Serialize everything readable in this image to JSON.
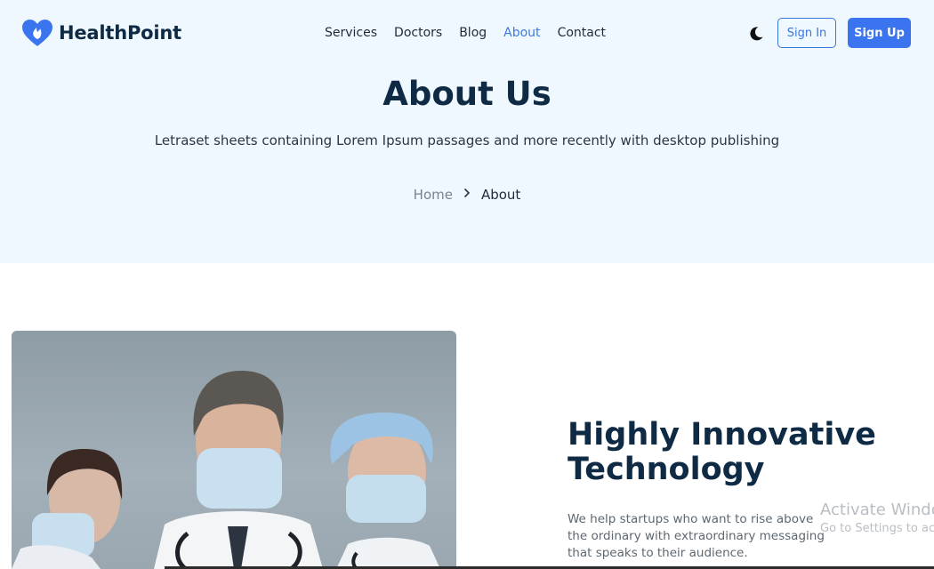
{
  "brand": {
    "name": "HealthPoint",
    "accent": "#3a74ef",
    "dark": "#0f2a44",
    "hero_bg": "#eef8fe"
  },
  "nav": {
    "items": [
      {
        "label": "Services",
        "active": false
      },
      {
        "label": "Doctors",
        "active": false
      },
      {
        "label": "Blog",
        "active": false
      },
      {
        "label": "About",
        "active": true
      },
      {
        "label": "Contact",
        "active": false
      }
    ],
    "theme_icon": "moon-icon",
    "signin_label": "Sign In",
    "signup_label": "Sign Up"
  },
  "hero": {
    "title": "About Us",
    "subtitle": "Letraset sheets containing Lorem Ipsum passages and more recently with desktop publishing",
    "breadcrumb": {
      "home": "Home",
      "separator_icon": "chevron-right-icon",
      "current": "About"
    }
  },
  "about": {
    "image_icon": "doctors-photo",
    "title_line1": "Highly Innovative",
    "title_line2": "Technology",
    "text": "We help startups who want to rise above the ordinary with extraordinary messaging that speaks to their audience."
  },
  "watermark": {
    "line1": "Activate Windows",
    "line2": "Go to Settings to activate Windows."
  }
}
